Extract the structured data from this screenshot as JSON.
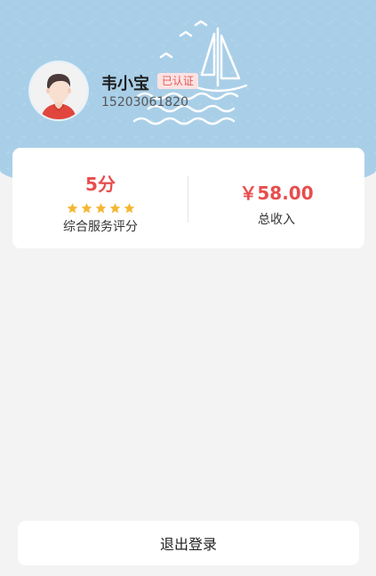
{
  "profile": {
    "name": "韦小宝",
    "badge": "已认证",
    "phone": "15203061820",
    "avatar_icon": "avatar-boy-icon"
  },
  "stats": {
    "score_value": "5分",
    "stars": 5,
    "score_label": "综合服务评分",
    "income_value": "￥58.00",
    "income_label": "总收入"
  },
  "logout": {
    "label": "退出登录"
  },
  "colors": {
    "header": "#a9cfe8",
    "accent_red": "#e84d4d",
    "star": "#f5b731",
    "badge_bg": "#fde2e2",
    "page_bg": "#f3f3f3"
  }
}
